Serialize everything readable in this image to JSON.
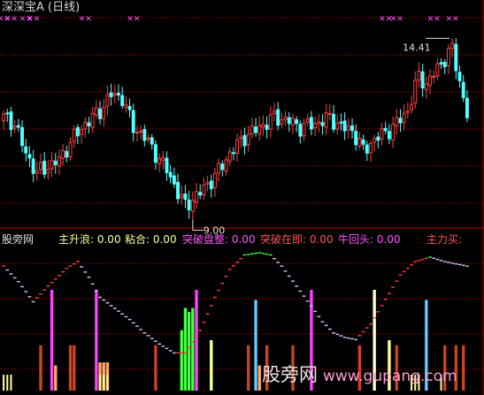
{
  "header": {
    "title": "深深宝A (日线)",
    "high_label": "14.41",
    "low_label": "9.00"
  },
  "indicator_panel": {
    "site_label": "股旁网",
    "labels": [
      {
        "text": "主升浪: 0.00",
        "color": "#ffff99"
      },
      {
        "text": "粘合: 0.00",
        "color": "#ffff99"
      },
      {
        "text": "突破盘整: 0.00",
        "color": "#ff55ff"
      },
      {
        "text": "突破在即: 0.00",
        "color": "#ff5555"
      },
      {
        "text": "牛回头: 0.00",
        "color": "#ff55ff"
      },
      {
        "text": "主力买:",
        "color": "#ff5555"
      }
    ]
  },
  "watermark": {
    "text": "股旁网",
    "url": "www.gupang.com"
  },
  "colors": {
    "up": "#ff4040",
    "down": "#54ffff",
    "grid": "#8b0000",
    "signal_marks": "#ff55ff",
    "curve_up": "#ff4040",
    "curve_down": "#c8c8ff",
    "curve_top": "#44ff44"
  },
  "chart_data": {
    "type": "candlestick",
    "title": "深深宝A (日线)",
    "price_range": [
      9.0,
      14.41
    ],
    "annotations": [
      {
        "text": "14.41",
        "kind": "high",
        "value": 14.41
      },
      {
        "text": "9.00",
        "kind": "low",
        "value": 9.0
      }
    ],
    "close_path": [
      [
        0,
        11.9
      ],
      [
        3,
        11.7
      ],
      [
        6,
        10.8
      ],
      [
        9,
        10.2
      ],
      [
        12,
        10.4
      ],
      [
        15,
        10.6
      ],
      [
        19,
        11.3
      ],
      [
        22,
        11.7
      ],
      [
        26,
        12.1
      ],
      [
        29,
        12.6
      ],
      [
        32,
        12.5
      ],
      [
        35,
        11.6
      ],
      [
        38,
        11.3
      ],
      [
        41,
        10.8
      ],
      [
        44,
        10.3
      ],
      [
        47,
        9.6
      ],
      [
        49,
        9.2
      ],
      [
        53,
        9.6
      ],
      [
        57,
        10.1
      ],
      [
        61,
        10.8
      ],
      [
        65,
        11.3
      ],
      [
        69,
        11.6
      ],
      [
        73,
        11.9
      ],
      [
        77,
        11.8
      ],
      [
        80,
        11.6
      ],
      [
        84,
        11.7
      ],
      [
        88,
        11.9
      ],
      [
        91,
        11.6
      ],
      [
        94,
        11.5
      ],
      [
        97,
        10.9
      ],
      [
        101,
        11.3
      ],
      [
        105,
        11.6
      ],
      [
        109,
        12.1
      ],
      [
        112,
        13.2
      ],
      [
        114,
        12.9
      ],
      [
        117,
        13.4
      ],
      [
        121,
        14.0
      ],
      [
        123,
        13.0
      ],
      [
        125,
        12.0
      ]
    ],
    "indicator": {
      "curve_range": [
        0,
        1
      ],
      "curve_path": [
        [
          0,
          0.88
        ],
        [
          4,
          0.74
        ],
        [
          8,
          0.56
        ],
        [
          12,
          0.7
        ],
        [
          17,
          0.86
        ],
        [
          20,
          0.92
        ],
        [
          23,
          0.78
        ],
        [
          26,
          0.6
        ],
        [
          30,
          0.5
        ],
        [
          34,
          0.4
        ],
        [
          38,
          0.28
        ],
        [
          42,
          0.18
        ],
        [
          46,
          0.1
        ],
        [
          49,
          0.1
        ],
        [
          53,
          0.3
        ],
        [
          57,
          0.6
        ],
        [
          61,
          0.85
        ],
        [
          65,
          0.98
        ],
        [
          69,
          1.0
        ],
        [
          72,
          0.98
        ],
        [
          75,
          0.88
        ],
        [
          79,
          0.7
        ],
        [
          83,
          0.52
        ],
        [
          86,
          0.38
        ],
        [
          89,
          0.28
        ],
        [
          92,
          0.24
        ],
        [
          95,
          0.22
        ],
        [
          99,
          0.36
        ],
        [
          103,
          0.58
        ],
        [
          107,
          0.8
        ],
        [
          111,
          0.92
        ],
        [
          115,
          0.96
        ],
        [
          119,
          0.92
        ],
        [
          125,
          0.88
        ]
      ],
      "bar_range": [
        0,
        1
      ],
      "bars": [
        {
          "i": 10,
          "h": 0.45,
          "c": "#cc4422"
        },
        {
          "i": 13,
          "h": 1.0,
          "c": "#ff44ff"
        },
        {
          "i": 14,
          "h": 0.25,
          "c": "#ffaa66"
        },
        {
          "i": 18,
          "h": 0.45,
          "c": "#cc4422"
        },
        {
          "i": 19,
          "h": 0.45,
          "c": "#cc4422"
        },
        {
          "i": 25,
          "h": 1.0,
          "c": "#ff44ff"
        },
        {
          "i": 26,
          "h": 0.28,
          "c": "#ffaa66"
        },
        {
          "i": 27,
          "h": 0.28,
          "c": "#ffaa66"
        },
        {
          "i": 28,
          "h": 0.28,
          "c": "#ffaa66"
        },
        {
          "i": 41,
          "h": 0.45,
          "c": "#cc4422"
        },
        {
          "i": 48,
          "h": 0.6,
          "c": "#44ff44"
        },
        {
          "i": 49,
          "h": 0.82,
          "c": "#44ff44"
        },
        {
          "i": 50,
          "h": 0.78,
          "c": "#44ff44"
        },
        {
          "i": 51,
          "h": 0.82,
          "c": "#44ff44"
        },
        {
          "i": 52,
          "h": 1.0,
          "c": "#ff44ff"
        },
        {
          "i": 56,
          "h": 0.5,
          "c": "#ffff99"
        },
        {
          "i": 66,
          "h": 0.45,
          "c": "#cc4422"
        },
        {
          "i": 68,
          "h": 0.9,
          "c": "#66ccff"
        },
        {
          "i": 69,
          "h": 0.25,
          "c": "#ffaa66"
        },
        {
          "i": 71,
          "h": 0.45,
          "c": "#cc4422"
        },
        {
          "i": 78,
          "h": 0.45,
          "c": "#cc4422"
        },
        {
          "i": 83,
          "h": 1.0,
          "c": "#ff44ff"
        },
        {
          "i": 96,
          "h": 0.45,
          "c": "#cc4422"
        },
        {
          "i": 100,
          "h": 1.0,
          "c": "#ffffcc"
        },
        {
          "i": 104,
          "h": 0.5,
          "c": "#ffff99"
        },
        {
          "i": 106,
          "h": 0.45,
          "c": "#cc4422"
        },
        {
          "i": 114,
          "h": 0.9,
          "c": "#66ccff"
        },
        {
          "i": 119,
          "h": 0.45,
          "c": "#cc4422"
        },
        {
          "i": 122,
          "h": 0.45,
          "c": "#cc4422"
        },
        {
          "i": 124,
          "h": 0.45,
          "c": "#cc4422"
        }
      ],
      "short_bars": [
        0,
        1,
        2,
        26,
        27,
        28,
        110,
        111,
        112,
        118
      ]
    },
    "signal_marks": [
      0,
      2,
      6,
      8,
      22,
      35,
      103,
      106,
      116,
      121
    ]
  }
}
